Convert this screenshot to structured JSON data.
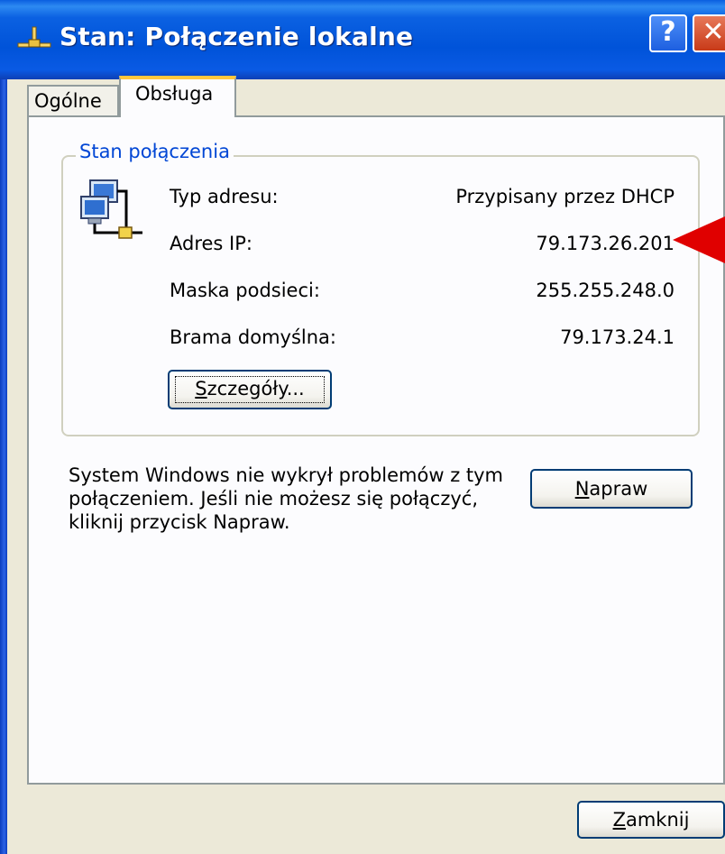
{
  "window": {
    "title": "Stan: Połączenie lokalne",
    "help_button": "?",
    "close_button": "✕"
  },
  "tabs": [
    {
      "label": "Ogólne",
      "active": false
    },
    {
      "label": "Obsługa",
      "active": true
    }
  ],
  "connection_status": {
    "group_title": "Stan połączenia",
    "rows": [
      {
        "label": "Typ adresu:",
        "value": "Przypisany przez DHCP"
      },
      {
        "label": "Adres IP:",
        "value": "79.173.26.201"
      },
      {
        "label": "Maska podsieci:",
        "value": "255.255.248.0"
      },
      {
        "label": "Brama domyślna:",
        "value": "79.173.24.1"
      }
    ],
    "details_button": {
      "mnemonic": "S",
      "rest": "zczegóły..."
    }
  },
  "repair": {
    "text_lines": [
      "System Windows nie wykrył problemów z tym",
      "połączeniem. Jeśli nie możesz się połączyć,",
      "kliknij przycisk Napraw."
    ],
    "button": {
      "mnemonic": "N",
      "rest": "apraw"
    }
  },
  "footer": {
    "close_button": {
      "mnemonic": "Z",
      "rest": "amknij"
    }
  },
  "colors": {
    "titlebar": "#0053d9",
    "dialog_bg": "#ece9d8",
    "group_title": "#0046d5",
    "active_tab_accent": "#ffc73c",
    "annotation_arrow": "#e00000"
  },
  "icons": {
    "title": "network-connection-icon",
    "status": "network-computers-icon",
    "annotation": "red-arrow-icon"
  }
}
